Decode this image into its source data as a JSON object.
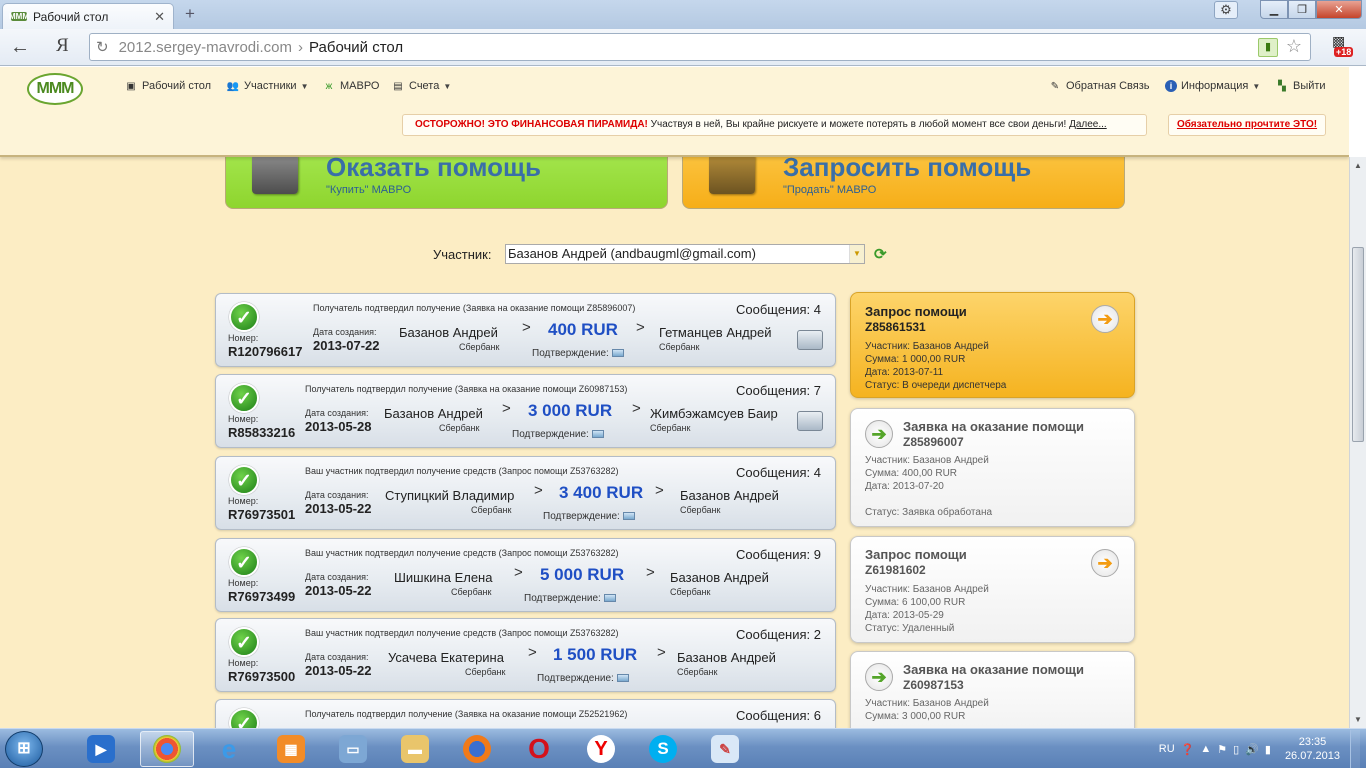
{
  "browser": {
    "tab_title": "Рабочий стол",
    "favicon_text": "МММ",
    "url_host": "2012.sergey-mavrodi.com",
    "url_sep": "›",
    "url_page": "Рабочий стол",
    "yandex_letter": "Я",
    "ext_badge": "+18"
  },
  "header": {
    "logo_text": "МММ",
    "nav": {
      "desktop": "Рабочий стол",
      "participants": "Участники",
      "mavro": "МАВРО",
      "accounts": "Счета",
      "feedback": "Обратная Связь",
      "info": "Информация",
      "exit": "Выйти"
    },
    "warning": {
      "red": "ОСТОРОЖНО! ЭТО ФИНАНСОВАЯ ПИРАМИДА!",
      "text": " Участвуя в ней, Вы крайне рискуете и можете потерять в любой момент все свои деньги!",
      "link": "Далее..."
    },
    "must_read": "Обязательно прочтите ЭТО!"
  },
  "actions": {
    "give_title": "Оказать помощь",
    "give_sub": "\"Купить\" МАВРО",
    "ask_title": "Запросить помощь",
    "ask_sub": "\"Продать\" МАВРО"
  },
  "participant": {
    "label": "Участник:",
    "value": "Базанов Андрей (andbaugml@gmail.com)"
  },
  "labels": {
    "number": "Номер:",
    "created": "Дата создания:",
    "confirmation": "Подтверждение:",
    "messages": "Сообщения:",
    "gt": ">"
  },
  "transactions": [
    {
      "status": "Получатель подтвердил получение (Заявка на оказание помощи Z85896007)",
      "messages": "4",
      "number": "R120796617",
      "date": "2013-07-22",
      "from": "Базанов Андрей",
      "from_bank": "Сбербанк",
      "amount": "400 RUR",
      "to": "Гетманцев Андрей",
      "to_bank": "Сбербанк"
    },
    {
      "status": "Получатель подтвердил получение (Заявка на оказание помощи Z60987153)",
      "messages": "7",
      "number": "R85833216",
      "date": "2013-05-28",
      "from": "Базанов Андрей",
      "from_bank": "Сбербанк",
      "amount": "3 000 RUR",
      "to": "Жимбэжамсуев Баир",
      "to_bank": "Сбербанк"
    },
    {
      "status": "Ваш участник подтвердил получение средств (Запрос помощи Z53763282)",
      "messages": "4",
      "number": "R76973501",
      "date": "2013-05-22",
      "from": "Ступицкий Владимир",
      "from_bank": "Сбербанк",
      "amount": "3 400 RUR",
      "to": "Базанов Андрей",
      "to_bank": "Сбербанк"
    },
    {
      "status": "Ваш участник подтвердил получение средств (Запрос помощи Z53763282)",
      "messages": "9",
      "number": "R76973499",
      "date": "2013-05-22",
      "from": "Шишкина Елена",
      "from_bank": "Сбербанк",
      "amount": "5 000 RUR",
      "to": "Базанов Андрей",
      "to_bank": "Сбербанк"
    },
    {
      "status": "Ваш участник подтвердил получение средств (Запрос помощи Z53763282)",
      "messages": "2",
      "number": "R76973500",
      "date": "2013-05-22",
      "from": "Усачева Екатерина",
      "from_bank": "Сбербанк",
      "amount": "1 500 RUR",
      "to": "Базанов Андрей",
      "to_bank": "Сбербанк"
    },
    {
      "status": "Получатель подтвердил получение (Заявка на оказание помощи Z52521962)",
      "messages": "6"
    }
  ],
  "requests": [
    {
      "title": "Запрос помощи",
      "number": "Z85861531",
      "participant": "Участник: Базанов Андрей",
      "sum": "Сумма: 1 000,00 RUR",
      "date": "Дата: 2013-07-11",
      "status": "Статус: В очереди диспетчера"
    },
    {
      "title": "Заявка на оказание помощи",
      "number": "Z85896007",
      "participant": "Участник: Базанов Андрей",
      "sum": "Сумма: 400,00 RUR",
      "date": "Дата: 2013-07-20",
      "status": "Статус: Заявка обработана"
    },
    {
      "title": "Запрос помощи",
      "number": "Z61981602",
      "participant": "Участник: Базанов Андрей",
      "sum": "Сумма: 6 100,00 RUR",
      "date": "Дата: 2013-05-29",
      "status": "Статус: Удаленный"
    },
    {
      "title": "Заявка на оказание помощи",
      "number": "Z60987153",
      "participant": "Участник: Базанов Андрей",
      "sum": "Сумма: 3 000,00 RUR"
    }
  ],
  "taskbar": {
    "lang": "RU",
    "time": "23:35",
    "date": "26.07.2013"
  }
}
